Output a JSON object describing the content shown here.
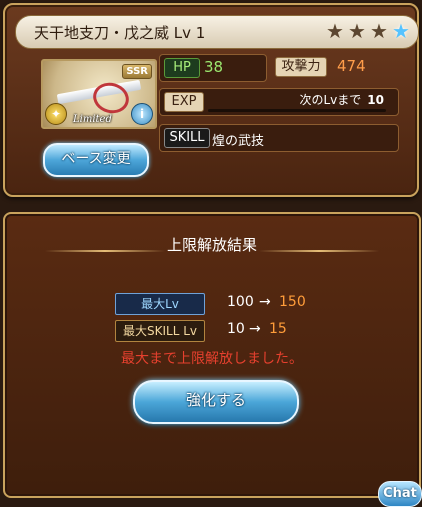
{
  "weapon": {
    "title": "天干地支刀・戊之威 Lv 1",
    "rarity_badge": "SSR",
    "limited_label": "Limited",
    "info_badge": "i",
    "element_badge": "✦",
    "stars": [
      "★",
      "★",
      "★",
      "★"
    ]
  },
  "stats": {
    "hp_label": "HP",
    "hp_value": "38",
    "atk_label": "攻撃力",
    "atk_value": "474",
    "exp_label": "EXP",
    "exp_next_label": "次のLvまで",
    "exp_next_value": "10",
    "exp_progress": 0,
    "skill_label": "SKILL",
    "skill_name": "煌の武技"
  },
  "buttons": {
    "base_change": "ベース変更",
    "enhance": "強化する",
    "chat": "Chat"
  },
  "result": {
    "title": "上限解放結果",
    "max_lv_label": "最大Lv",
    "max_lv_from": "100",
    "max_lv_to": "150",
    "max_skill_label": "最大SKILL Lv",
    "max_skill_from": "10",
    "max_skill_to": "15",
    "arrow": "→",
    "message": "最大まで上限解放しました。"
  }
}
